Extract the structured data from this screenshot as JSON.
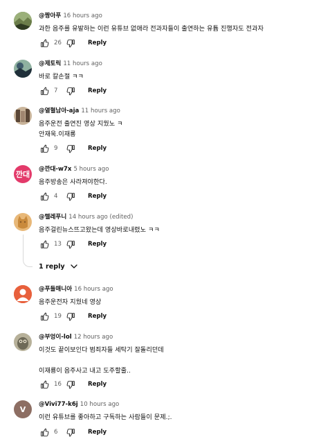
{
  "comments": [
    {
      "handle": "@짱아푸",
      "time": "16 hours ago",
      "text": "과한 음주를 유발하는 이런 유튜브 없애라 전과자들이 출연하는 유튭 진행자도 전과자",
      "likes": "26",
      "reply_label": "Reply",
      "avatar": {
        "icon": "landscape-avatar",
        "colors": [
          "#6b7d4a",
          "#9bb07a",
          "#2f3b22"
        ]
      }
    },
    {
      "handle": "@제토릭",
      "time": "11 hours ago",
      "text": "바로 칼손절 ㅋㅋ",
      "likes": "7",
      "reply_label": "Reply",
      "avatar": {
        "icon": "landscape-avatar",
        "colors": [
          "#3f5a6b",
          "#8fb1a0",
          "#20303a"
        ]
      }
    },
    {
      "handle": "@열혈남아-aja",
      "time": "11 hours ago",
      "text": "음주운전 출연진 영상 지웠노 ㅋ\n안재욱.이재룡",
      "likes": "9",
      "reply_label": "Reply",
      "avatar": {
        "icon": "photo-avatar",
        "colors": [
          "#a08670",
          "#5a4636",
          "#c9b49a"
        ]
      }
    },
    {
      "handle": "@깐대-w7x",
      "time": "5 hours ago",
      "text": "음주방송은 사라져야한다.",
      "likes": "4",
      "reply_label": "Reply",
      "avatar": {
        "icon": "letter-avatar",
        "letter": "깐대",
        "colors": [
          "#e33a6a"
        ]
      }
    },
    {
      "handle": "@텔레푸니",
      "time": "14 hours ago (edited)",
      "text": "음주걸린뉴스뜨고왔는데 영상바로내렸노 ㅋㅋ",
      "likes": "13",
      "reply_label": "Reply",
      "avatar": {
        "icon": "cat-avatar",
        "colors": [
          "#c98a3c",
          "#8a5a26",
          "#e8b878"
        ]
      }
    },
    {
      "handle": "@푸들매니아",
      "time": "16 hours ago",
      "text": "음주운전자 지웠네 영상",
      "likes": "19",
      "reply_label": "Reply",
      "avatar": {
        "icon": "default-person-avatar",
        "colors": [
          "#e8603c",
          "#ffffff"
        ]
      }
    },
    {
      "handle": "@부엉이-lol",
      "time": "12 hours ago",
      "text": "이것도 끝이보인다 범죄자들 세탁기 잘돌리던데\n\n이재룡이 음주사고 내고 도주할줄..",
      "likes": "16",
      "reply_label": "Reply",
      "avatar": {
        "icon": "owl-photo-avatar",
        "colors": [
          "#6e6a58",
          "#b7b19a",
          "#3b382e"
        ]
      }
    },
    {
      "handle": "@Vivi77-k6j",
      "time": "10 hours ago",
      "text": "이런 유튜브를 좋아하고 구독하는 사람들이 문제.;.",
      "likes": "6",
      "reply_label": "Reply",
      "avatar": {
        "icon": "letter-avatar",
        "letter": "V",
        "colors": [
          "#8d6e63"
        ]
      }
    }
  ],
  "replies_toggle": {
    "label": "1 reply",
    "icon": "chevron-down-icon"
  },
  "icons": {
    "like": "thumbs-up-icon",
    "dislike": "thumbs-down-icon"
  },
  "colors": {
    "text": "#0f0f0f",
    "secondary": "#606060",
    "background": "#ffffff"
  }
}
